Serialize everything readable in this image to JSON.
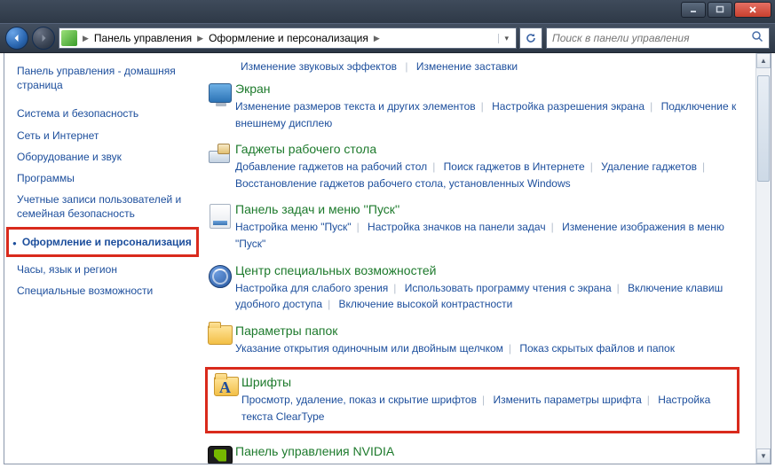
{
  "address": {
    "seg1": "Панель управления",
    "seg2": "Оформление и персонализация"
  },
  "search": {
    "placeholder": "Поиск в панели управления"
  },
  "sidebar": {
    "home": "Панель управления - домашняя страница",
    "items": [
      "Система и безопасность",
      "Сеть и Интернет",
      "Оборудование и звук",
      "Программы",
      "Учетные записи пользователей и семейная безопасность",
      "Оформление и персонализация",
      "Часы, язык и регион",
      "Специальные возможности"
    ],
    "current_index": 5
  },
  "top": {
    "a": "Изменение звуковых эффектов",
    "b": "Изменение заставки"
  },
  "sections": [
    {
      "id": "display",
      "title": "Экран",
      "links": [
        "Изменение размеров текста и других элементов",
        "Настройка разрешения экрана",
        "Подключение к внешнему дисплею"
      ]
    },
    {
      "id": "gadgets",
      "title": "Гаджеты рабочего стола",
      "links": [
        "Добавление гаджетов на рабочий стол",
        "Поиск гаджетов в Интернете",
        "Удаление гаджетов",
        "Восстановление гаджетов рабочего стола, установленных Windows"
      ]
    },
    {
      "id": "taskbar",
      "title": "Панель задач и меню ''Пуск''",
      "links": [
        "Настройка меню \"Пуск\"",
        "Настройка значков на панели задач",
        "Изменение изображения в меню \"Пуск\""
      ]
    },
    {
      "id": "ease",
      "title": "Центр специальных возможностей",
      "links": [
        "Настройка для слабого зрения",
        "Использовать программу чтения с экрана",
        "Включение клавиш удобного доступа",
        "Включение высокой контрастности"
      ]
    },
    {
      "id": "folders",
      "title": "Параметры папок",
      "links": [
        "Указание открытия одиночным или двойным щелчком",
        "Показ скрытых файлов и папок"
      ]
    },
    {
      "id": "fonts",
      "title": "Шрифты",
      "links": [
        "Просмотр, удаление, показ и скрытие шрифтов",
        "Изменить параметры шрифта",
        "Настройка текста ClearType"
      ],
      "boxed": true
    },
    {
      "id": "nvidia",
      "title": "Панель управления NVIDIA",
      "links": []
    }
  ]
}
